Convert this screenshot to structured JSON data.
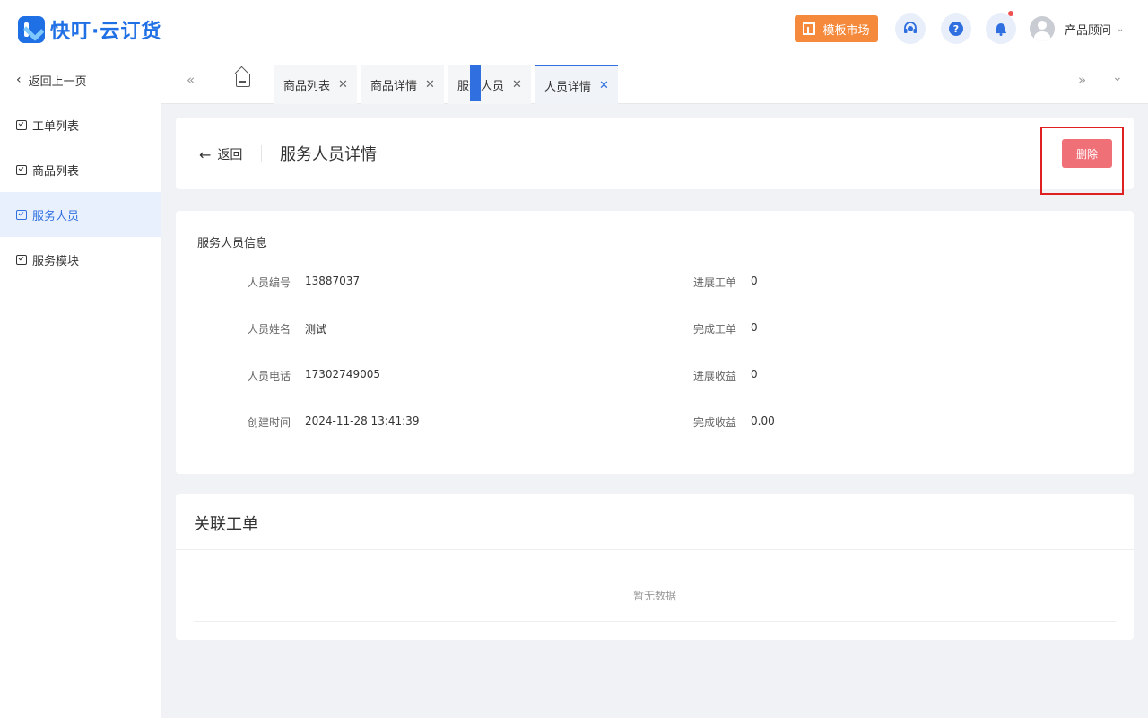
{
  "header": {
    "logo_text": "快叮·云订货",
    "template_market": "模板市场",
    "service_icon": "headset-icon",
    "help_icon": "question-icon",
    "bell_icon": "bell-icon",
    "user_name": "产品顾问",
    "accent_color": "#2f6fe0",
    "template_btn_color": "#f58a3c"
  },
  "sidebar": {
    "back_label": "返回上一页",
    "items": [
      {
        "label": "工单列表"
      },
      {
        "label": "商品列表"
      },
      {
        "label": "服务人员"
      },
      {
        "label": "服务模块"
      }
    ]
  },
  "tabs": [
    {
      "label": "商品列表"
    },
    {
      "label": "商品详情"
    },
    {
      "label": "服务人员"
    },
    {
      "label": "人员详情"
    }
  ],
  "detail": {
    "back_label": "返回",
    "title": "服务人员详情",
    "delete_label": "删除",
    "delete_color": "#f07077"
  },
  "info": {
    "section_title": "服务人员信息",
    "left": [
      {
        "label": "人员编号",
        "value": "13887037"
      },
      {
        "label": "人员姓名",
        "value": "测试"
      },
      {
        "label": "人员电话",
        "value": "17302749005"
      },
      {
        "label": "创建时间",
        "value": "2024-11-28 13:41:39"
      }
    ],
    "right": [
      {
        "label": "进展工单",
        "value": "0"
      },
      {
        "label": "完成工单",
        "value": "0"
      },
      {
        "label": "进展收益",
        "value": "0"
      },
      {
        "label": "完成收益",
        "value": "0.00"
      }
    ]
  },
  "orders": {
    "title": "关联工单",
    "empty_text": "暂无数据"
  }
}
